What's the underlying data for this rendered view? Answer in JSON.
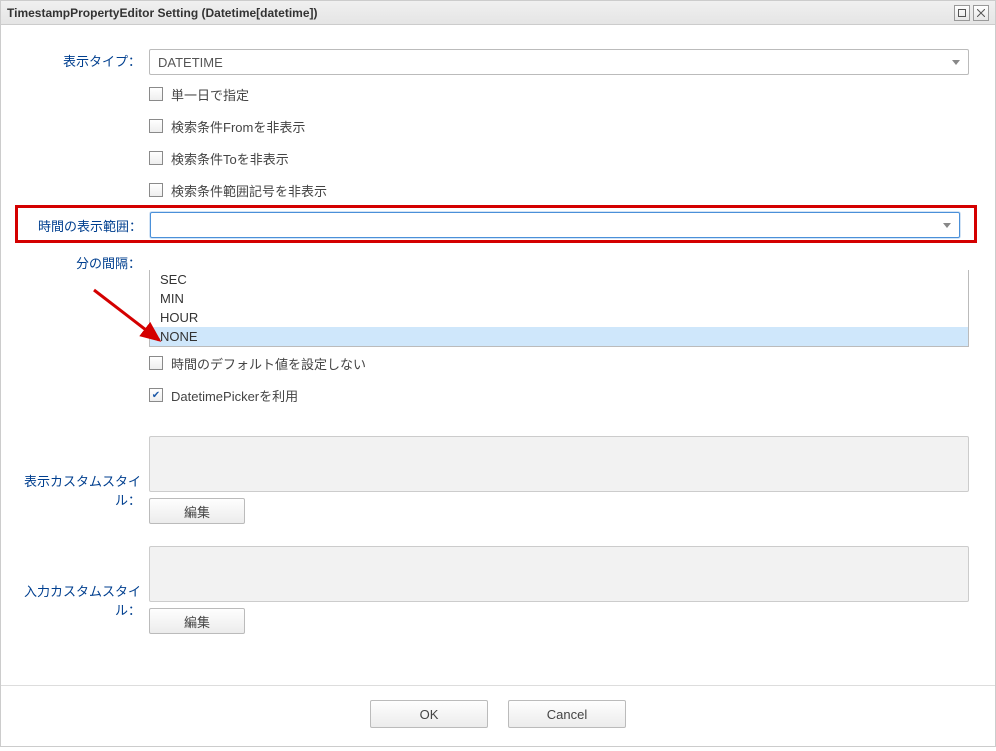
{
  "window": {
    "title": "TimestampPropertyEditor Setting (Datetime[datetime])"
  },
  "labels": {
    "display_type": "表示タイプ：",
    "time_display_range": "時間の表示範囲：",
    "minute_interval": "分の間隔：",
    "display_custom_style": "表示カスタムスタイル：",
    "input_custom_style": "入力カスタムスタイル："
  },
  "display_type_select": {
    "value": "DATETIME"
  },
  "checkboxes": {
    "single_day": {
      "label": "単一日で指定",
      "checked": false
    },
    "hide_from": {
      "label": "検索条件Fromを非表示",
      "checked": false
    },
    "hide_to": {
      "label": "検索条件Toを非表示",
      "checked": false
    },
    "hide_range_sign": {
      "label": "検索条件範囲記号を非表示",
      "checked": false
    },
    "no_time_default": {
      "label": "時間のデフォルト値を設定しない",
      "checked": false
    },
    "use_datetime_picker": {
      "label": "DatetimePickerを利用",
      "checked": true
    }
  },
  "time_range_select": {
    "value": "",
    "options": [
      "SEC",
      "MIN",
      "HOUR",
      "NONE"
    ],
    "highlighted": "NONE"
  },
  "buttons": {
    "edit": "編集",
    "ok": "OK",
    "cancel": "Cancel"
  },
  "colors": {
    "highlight_border": "#d40000",
    "option_highlight_bg": "#cfe7fb",
    "label_color": "#003f8f"
  }
}
